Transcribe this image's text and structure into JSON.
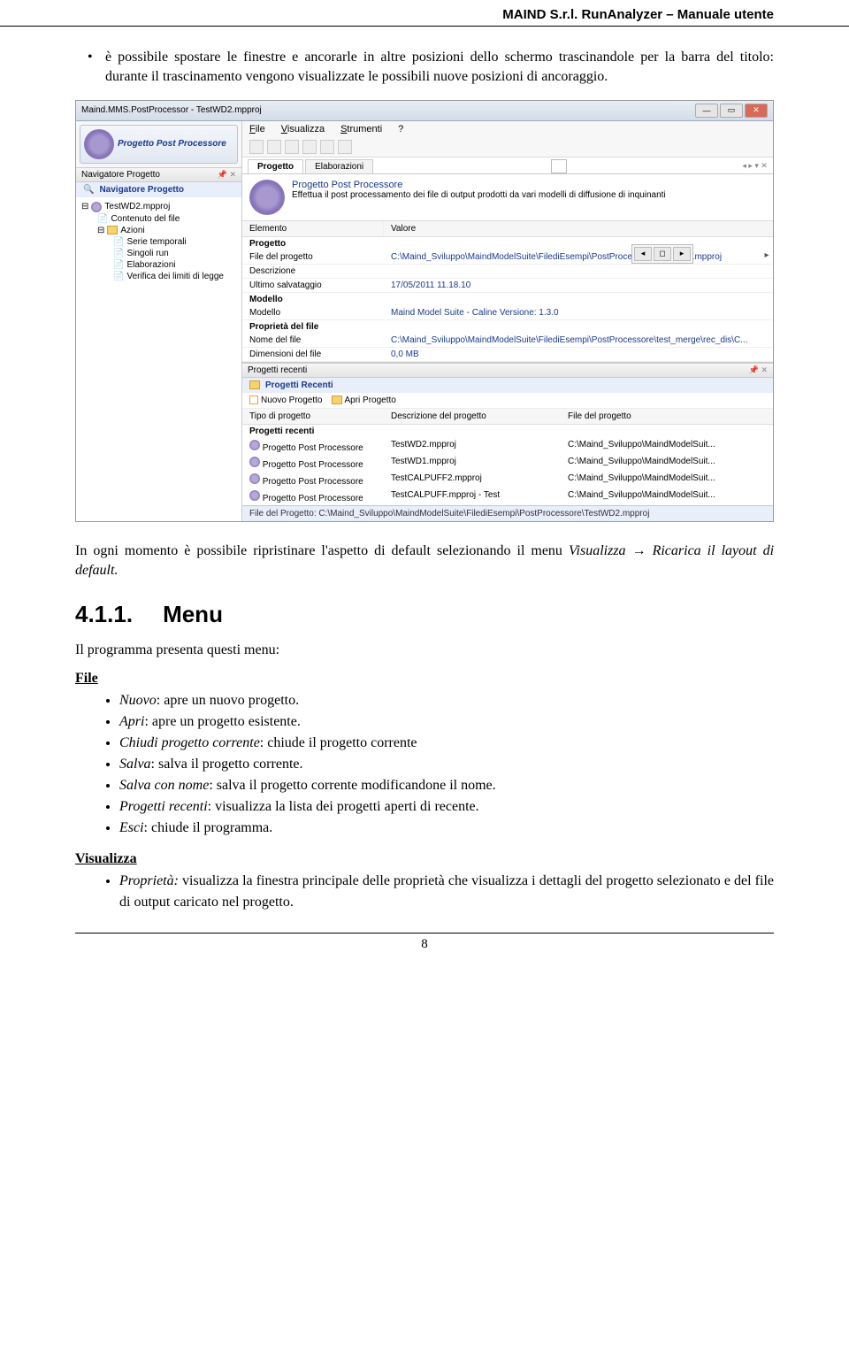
{
  "header": "MAIND S.r.l. RunAnalyzer – Manuale utente",
  "intro_bullet": "è possibile spostare le finestre e ancorarle in altre posizioni dello schermo trascinandole per la barra del titolo: durante il trascinamento vengono visualizzate le possibili nuove posizioni di ancoraggio.",
  "app": {
    "title": "Maind.MMS.PostProcessor - TestWD2.mpproj",
    "ribbon_label": "Progetto Post Processore",
    "nav_panel_title": "Navigatore Progetto",
    "nav_panel_header_sub": "Navigatore Progetto",
    "tree": {
      "root": "TestWD2.mpproj",
      "n1": "Contenuto del file",
      "n2": "Azioni",
      "n2a": "Serie temporali",
      "n2b": "Singoli run",
      "n2c": "Elaborazioni",
      "n2d": "Verifica dei limiti di legge"
    },
    "menus": {
      "file": "File",
      "visualizza": "Visualizza",
      "strumenti": "Strumenti",
      "help": "?"
    },
    "tabs": {
      "progetto": "Progetto",
      "elaborazioni": "Elaborazioni"
    },
    "info_title": "Progetto Post Processore",
    "info_desc": "Effettua il post processamento dei file di output prodotti da vari modelli di diffusione di inquinanti",
    "grid": {
      "col_elemento": "Elemento",
      "col_valore": "Valore",
      "sec_progetto": "Progetto",
      "file_progetto_l": "File del progetto",
      "file_progetto_v": "C:\\Maind_Sviluppo\\MaindModelSuite\\FilediEsempi\\PostProcessore\\TestWD2.mpproj",
      "descrizione_l": "Descrizione",
      "ultimo_l": "Ultimo salvataggio",
      "ultimo_v": "17/05/2011 11.18.10",
      "sec_modello": "Modello",
      "modello_l": "Modello",
      "modello_v": "Maind Model Suite - Caline  Versione: 1.3.0",
      "sec_proprieta": "Proprietà del file",
      "nome_l": "Nome del file",
      "nome_v": "C:\\Maind_Sviluppo\\MaindModelSuite\\FilediEsempi\\PostProcessore\\test_merge\\rec_dis\\C...",
      "dim_l": "Dimensioni del file",
      "dim_v": "0,0 MB"
    },
    "recent": {
      "panel_title": "Progetti recenti",
      "header_blue": "Progetti Recenti",
      "nuovo": "Nuovo Progetto",
      "apri": "Apri Progetto",
      "col_tipo": "Tipo di progetto",
      "col_desc": "Descrizione del progetto",
      "col_file": "File del progetto",
      "section": "Progetti recenti",
      "rows": [
        {
          "tipo": "Progetto Post Processore",
          "desc": "TestWD2.mpproj",
          "file": "C:\\Maind_Sviluppo\\MaindModelSuit..."
        },
        {
          "tipo": "Progetto Post Processore",
          "desc": "TestWD1.mpproj",
          "file": "C:\\Maind_Sviluppo\\MaindModelSuit..."
        },
        {
          "tipo": "Progetto Post Processore",
          "desc": "TestCALPUFF2.mpproj",
          "file": "C:\\Maind_Sviluppo\\MaindModelSuit..."
        },
        {
          "tipo": "Progetto Post Processore",
          "desc": "TestCALPUFF.mpproj - Test",
          "file": "C:\\Maind_Sviluppo\\MaindModelSuit..."
        }
      ]
    },
    "statusbar": "File del Progetto:  C:\\Maind_Sviluppo\\MaindModelSuite\\FilediEsempi\\PostProcessore\\TestWD2.mpproj"
  },
  "para_after": {
    "p1a": "In ogni momento è possibile ripristinare l'aspetto di default selezionando il menu ",
    "p1b": "Visualizza",
    "p1c": " → ",
    "p1d": "Ricarica il layout di default.",
    "p1e": ""
  },
  "section_411_num": "4.1.1.",
  "section_411_title": "Menu",
  "menu_intro": "Il programma presenta questi menu:",
  "file_heading": "File",
  "file_items": [
    {
      "name": "Nuovo",
      "desc": ": apre un nuovo progetto."
    },
    {
      "name": "Apri",
      "desc": ": apre un progetto esistente."
    },
    {
      "name": "Chiudi progetto corrente",
      "desc": ": chiude il progetto corrente"
    },
    {
      "name": "Salva",
      "desc": ": salva il progetto corrente."
    },
    {
      "name": "Salva con nome",
      "desc": ": salva il progetto corrente modificandone il nome."
    },
    {
      "name": "Progetti recenti",
      "desc": ": visualizza la lista dei progetti aperti di recente."
    },
    {
      "name": "Esci",
      "desc": ": chiude il programma."
    }
  ],
  "visualizza_heading": "Visualizza",
  "visualizza_items": [
    {
      "name": "Proprietà:",
      "desc": " visualizza la finestra principale delle proprietà che visualizza i dettagli del progetto selezionato e del file di output caricato nel progetto."
    }
  ],
  "page_number": "8"
}
